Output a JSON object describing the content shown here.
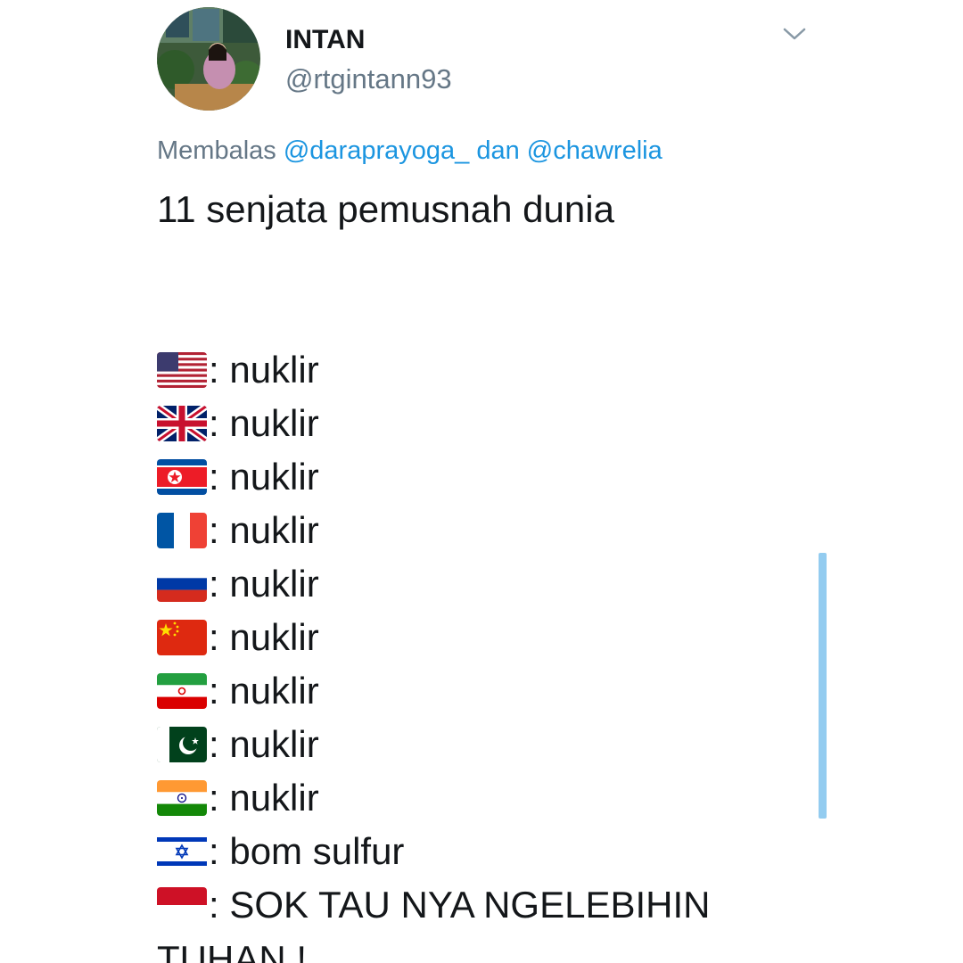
{
  "user": {
    "display_name": "INTAN",
    "handle": "@rtgintann93"
  },
  "reply": {
    "prefix": "Membalas",
    "mention_1": "@daraprayoga_",
    "connector": "dan",
    "mention_2": "@chawrelia"
  },
  "tweet": {
    "headline": "11 senjata pemusnah dunia",
    "items": [
      {
        "flag": "us-flag-icon",
        "text": ": nuklir"
      },
      {
        "flag": "uk-flag-icon",
        "text": ": nuklir"
      },
      {
        "flag": "north-korea-flag-icon",
        "text": ": nuklir"
      },
      {
        "flag": "france-flag-icon",
        "text": ": nuklir"
      },
      {
        "flag": "russia-flag-icon",
        "text": ": nuklir"
      },
      {
        "flag": "china-flag-icon",
        "text": ": nuklir"
      },
      {
        "flag": "iran-flag-icon",
        "text": ": nuklir"
      },
      {
        "flag": "pakistan-flag-icon",
        "text": ": nuklir"
      },
      {
        "flag": "india-flag-icon",
        "text": ": nuklir"
      },
      {
        "flag": "israel-flag-icon",
        "text": ": bom sulfur"
      },
      {
        "flag": "indonesia-flag-icon",
        "text": ": SOK TAU NYA NGELEBIHIN"
      }
    ],
    "last_line": "TUHAN !"
  },
  "colors": {
    "text": "#14171a",
    "secondary": "#657786",
    "link": "#1b95e0",
    "scrollbar": "#93ccf0"
  }
}
